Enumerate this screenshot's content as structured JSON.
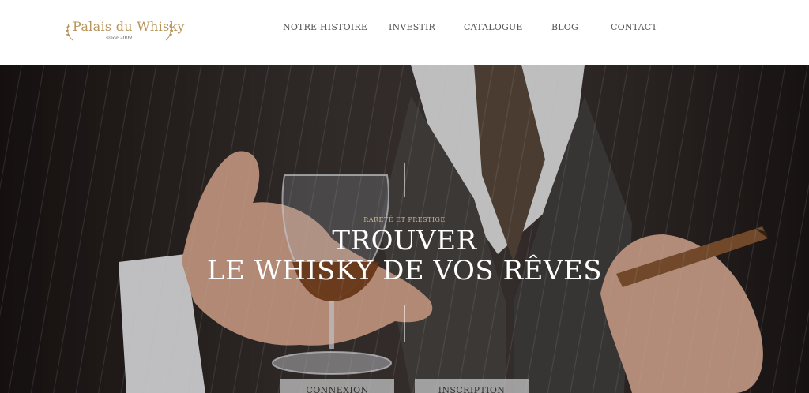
{
  "brand": {
    "name": "Palais du Whisky",
    "tagline": "since 2009",
    "accent_color": "#b8955a"
  },
  "nav": {
    "items": [
      {
        "label": "NOTRE HISTOIRE"
      },
      {
        "label": "INVESTIR"
      },
      {
        "label": "CATALOGUE"
      },
      {
        "label": "BLOG"
      },
      {
        "label": "CONTACT"
      }
    ]
  },
  "hero": {
    "kicker": "RARETÉ ET PRESTIGE",
    "title_line1": "TROUVER",
    "title_line2": "LE WHISKY DE VOS RÊVES",
    "buttons": {
      "login": "CONNEXION",
      "signup": "INSCRIPTION"
    }
  },
  "icons": {
    "logo_left": "laurel-branch-icon",
    "logo_right": "laurel-branch-icon"
  }
}
